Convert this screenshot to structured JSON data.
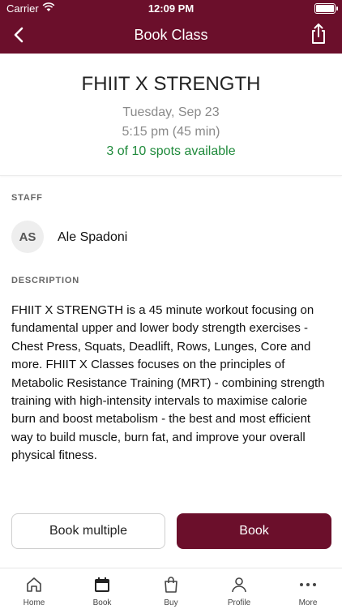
{
  "status_bar": {
    "carrier": "Carrier",
    "time": "12:09 PM"
  },
  "nav": {
    "title": "Book Class",
    "back_icon": "chevron-left-icon",
    "share_icon": "share-icon"
  },
  "class": {
    "title": "FHIIT X STRENGTH",
    "date": "Tuesday, Sep 23",
    "time": "5:15 pm (45 min)",
    "spots": "3 of 10 spots available"
  },
  "staff": {
    "label": "STAFF",
    "initials": "AS",
    "name": "Ale Spadoni"
  },
  "description": {
    "label": "DESCRIPTION",
    "text": "FHIIT X STRENGTH is a 45 minute workout focusing on  fundamental upper and lower body strength exercises - Chest Press, Squats, Deadlift, Rows, Lunges, Core and more.   FHIIT X Classes focuses on the principles of Metabolic Resistance Training (MRT) - combining strength training with high-intensity intervals to maximise calorie burn and boost metabolism - the best and most efficient way to build muscle, burn fat, and improve your overall physical fitness."
  },
  "actions": {
    "book_multiple": "Book multiple",
    "book": "Book"
  },
  "tabs": [
    {
      "label": "Home",
      "icon": "home-icon"
    },
    {
      "label": "Book",
      "icon": "calendar-icon"
    },
    {
      "label": "Buy",
      "icon": "shopping-bag-icon"
    },
    {
      "label": "Profile",
      "icon": "person-icon"
    },
    {
      "label": "More",
      "icon": "more-dots-icon"
    }
  ],
  "colors": {
    "brand": "#6b0f2b",
    "spots_available": "#1f8a3b",
    "muted_text": "#8a8a8a"
  }
}
